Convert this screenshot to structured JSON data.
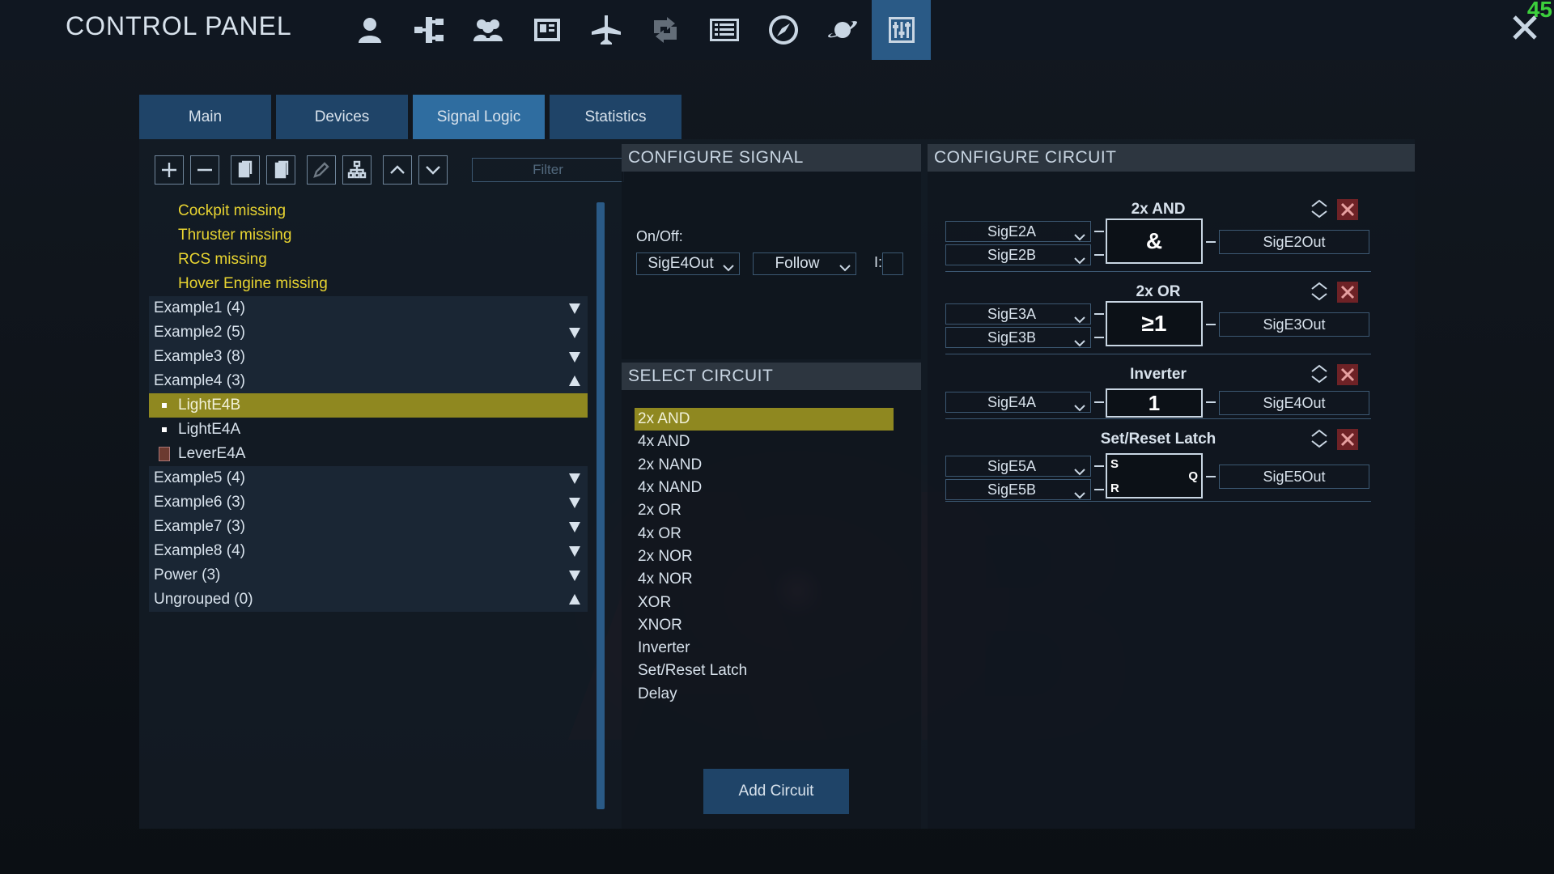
{
  "header": {
    "title": "CONTROL PANEL",
    "fps": "45",
    "icons": [
      "player-icon",
      "structure-icon",
      "crew-icon",
      "blueprint-icon",
      "ship-icon",
      "transfer-icon",
      "list-icon",
      "compass-icon",
      "planet-icon",
      "control-panel-icon"
    ],
    "active_icon": "control-panel-icon"
  },
  "tabs": [
    {
      "label": "Main",
      "active": false
    },
    {
      "label": "Devices",
      "active": false
    },
    {
      "label": "Signal Logic",
      "active": true
    },
    {
      "label": "Statistics",
      "active": false
    }
  ],
  "list": {
    "filter_placeholder": "Filter",
    "toolbar": [
      "add-icon",
      "remove-icon",
      "copy-icon",
      "paste-icon",
      "edit-icon",
      "hierarchy-icon",
      "move-up-icon",
      "move-down-icon"
    ],
    "warnings": [
      "Cockpit missing",
      "Thruster missing",
      "RCS missing",
      "Hover Engine missing"
    ],
    "groups_top": [
      "Example1 (4)",
      "Example2 (5)",
      "Example3 (8)",
      "Example4 (3)"
    ],
    "example4_children": [
      "LightE4B",
      "LightE4A",
      "LeverE4A"
    ],
    "groups_bottom": [
      "Example5 (4)",
      "Example6 (3)",
      "Example7 (3)",
      "Example8 (4)",
      "Power (3)",
      "Ungrouped (0)"
    ],
    "selected_child": "LightE4B"
  },
  "configure_signal": {
    "header": "CONFIGURE SIGNAL",
    "onoff_label": "On/Off:",
    "signal_value": "SigE4Out",
    "mode_value": "Follow",
    "i_label": "I:"
  },
  "select_circuit": {
    "header": "SELECT CIRCUIT",
    "items": [
      "2x AND",
      "4x AND",
      "2x NAND",
      "4x NAND",
      "2x OR",
      "4x OR",
      "2x NOR",
      "4x NOR",
      "XOR",
      "XNOR",
      "Inverter",
      "Set/Reset Latch",
      "Delay"
    ],
    "selected": "2x AND",
    "add_button": "Add Circuit"
  },
  "configure_circuit": {
    "header": "CONFIGURE CIRCUIT",
    "circuits": [
      {
        "title": "2x AND",
        "inputs": [
          "SigE2A",
          "SigE2B"
        ],
        "symbol": "&",
        "output": "SigE2Out"
      },
      {
        "title": "2x OR",
        "inputs": [
          "SigE3A",
          "SigE3B"
        ],
        "symbol": "≥1",
        "output": "SigE3Out"
      },
      {
        "title": "Inverter",
        "inputs": [
          "SigE4A"
        ],
        "symbol": "1",
        "output": "SigE4Out"
      },
      {
        "title": "Set/Reset Latch",
        "inputs": [
          "SigE5A",
          "SigE5B"
        ],
        "symbol": "",
        "pins": {
          "s": "S",
          "r": "R",
          "q": "Q"
        },
        "output": "SigE5Out"
      }
    ]
  }
}
